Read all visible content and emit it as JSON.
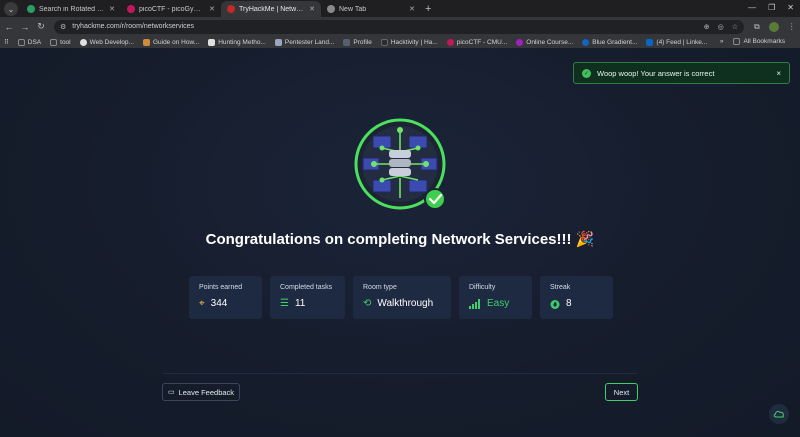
{
  "browser": {
    "tabs": [
      {
        "title": "Search in Rotated Sorted",
        "favicon_color": "#2b9e63",
        "active": false
      },
      {
        "title": "picoCTF - picoGym Chall",
        "favicon_color": "#c2185b",
        "active": false
      },
      {
        "title": "TryHackMe | Network Se",
        "favicon_color": "#c62828",
        "active": true
      },
      {
        "title": "New Tab",
        "favicon_color": "#8a8a8a",
        "active": false
      }
    ],
    "url": "tryhackme.com/r/room/networkservices",
    "bookmarks": [
      {
        "label": "DSA",
        "color": "#8a8a8a"
      },
      {
        "label": "tool",
        "color": "#8a8a8a"
      },
      {
        "label": "Web Develop...",
        "color": "#e0e0e0"
      },
      {
        "label": "Guide on How...",
        "color": "#d08a3a"
      },
      {
        "label": "Hunting Metho...",
        "color": "#e0e0e0"
      },
      {
        "label": "Pentester Land...",
        "color": "#9aa6c0"
      },
      {
        "label": "Profile",
        "color": "#556070"
      },
      {
        "label": "Hacktivity | Ha...",
        "color": "#2b2b2b"
      },
      {
        "label": "picoCTF - CMU...",
        "color": "#c2185b"
      },
      {
        "label": "Online Course...",
        "color": "#a020c0"
      },
      {
        "label": "Blue Gradient...",
        "color": "#1565c0"
      },
      {
        "label": "(4) Feed | Linke...",
        "color": "#0a66c2"
      }
    ],
    "all_bookmarks": "All Bookmarks"
  },
  "toast": {
    "message": "Woop woop! Your answer is correct",
    "close": "×"
  },
  "main": {
    "title": "Congratulations on completing Network Services!!! 🎉",
    "stats": [
      {
        "label": "Points earned",
        "value": "344",
        "icon": "target-icon",
        "color": "#f2c14e"
      },
      {
        "label": "Completed tasks",
        "value": "11",
        "icon": "checklist-icon",
        "color": "#3fcf6a"
      },
      {
        "label": "Room type",
        "value": "Walkthrough",
        "icon": "path-icon",
        "color": "#3fcf6a"
      },
      {
        "label": "Difficulty",
        "value": "Easy",
        "icon": "signal-bars-icon",
        "color": "#3fcf6a"
      },
      {
        "label": "Streak",
        "value": "8",
        "icon": "flame-icon",
        "color": "#3fcf6a"
      }
    ],
    "feedback_label": "Leave Feedback",
    "next_label": "Next"
  }
}
